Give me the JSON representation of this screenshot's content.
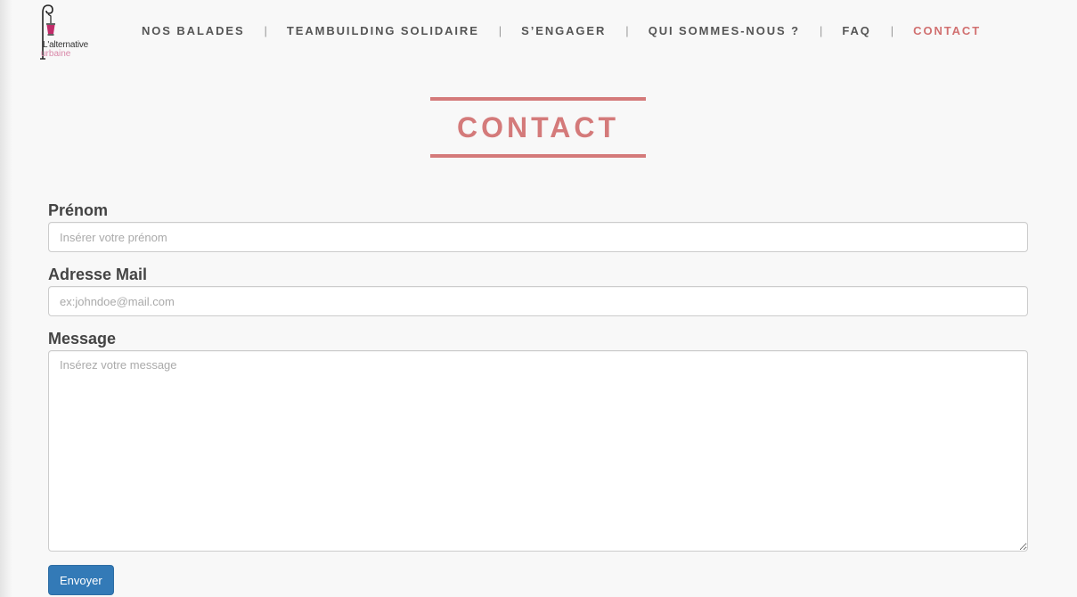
{
  "brand": {
    "logo_line1": "L'alternative",
    "logo_line2": "urbaine",
    "accent_color": "#d47a7a",
    "logo_pink": "#d987a8"
  },
  "nav": {
    "items": [
      {
        "label": "NOS BALADES",
        "active": false
      },
      {
        "label": "TEAMBUILDING SOLIDAIRE",
        "active": false
      },
      {
        "label": "S’ENGAGER",
        "active": false
      },
      {
        "label": "QUI SOMMES-NOUS ?",
        "active": false
      },
      {
        "label": "FAQ",
        "active": false
      },
      {
        "label": "CONTACT",
        "active": true
      }
    ],
    "separator": "|"
  },
  "page": {
    "title": "CONTACT"
  },
  "form": {
    "firstname": {
      "label": "Prénom",
      "placeholder": "Insérer votre prénom",
      "value": ""
    },
    "email": {
      "label": "Adresse Mail",
      "placeholder": "ex:johndoe@mail.com",
      "value": ""
    },
    "message": {
      "label": "Message",
      "placeholder": "Insérez votre message",
      "value": ""
    },
    "submit_label": "Envoyer",
    "submit_color": "#337ab7"
  }
}
